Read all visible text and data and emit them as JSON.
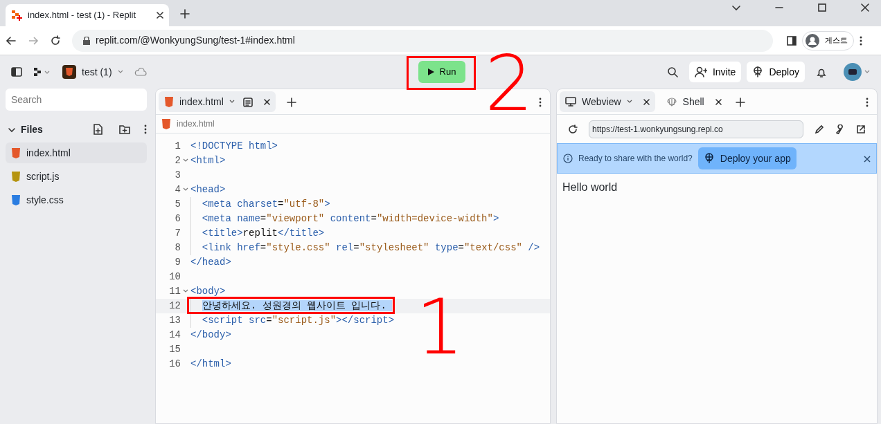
{
  "browser": {
    "tab_title": "index.html - test (1) - Replit",
    "url": "replit.com/@WonkyungSung/test-1#index.html",
    "profile": "게스트"
  },
  "toolbar": {
    "project": "test (1)",
    "run": "Run",
    "invite": "Invite",
    "deploy": "Deploy"
  },
  "sidebar": {
    "search_placeholder": "Search",
    "section": "Files",
    "expanded": true,
    "files": [
      {
        "name": "index.html",
        "kind": "html",
        "selected": true
      },
      {
        "name": "script.js",
        "kind": "js",
        "selected": false
      },
      {
        "name": "style.css",
        "kind": "css",
        "selected": false
      }
    ]
  },
  "editor": {
    "tab": "index.html",
    "breadcrumb": "index.html",
    "lines": [
      {
        "n": "1",
        "foldable": false,
        "selected": false,
        "indented": false,
        "segs": [
          {
            "kind": "tag",
            "text": "<!DOCTYPE html>"
          }
        ]
      },
      {
        "n": "2",
        "foldable": true,
        "selected": false,
        "indented": false,
        "segs": [
          {
            "kind": "tag",
            "text": "<html>"
          }
        ]
      },
      {
        "n": "3",
        "foldable": false,
        "selected": false
      },
      {
        "n": "4",
        "foldable": true,
        "selected": false,
        "indented": false,
        "segs": [
          {
            "kind": "tag",
            "text": "<head>"
          }
        ]
      },
      {
        "n": "5",
        "foldable": false,
        "selected": false,
        "indented": true,
        "segs": [
          {
            "kind": "tag",
            "text": "<meta"
          },
          {
            "kind": "attr",
            "text": "charset"
          },
          {
            "kind": "punct",
            "text": "="
          },
          {
            "kind": "str",
            "text": "\"utf-8\""
          },
          {
            "kind": "tag",
            "text": ">"
          }
        ]
      },
      {
        "n": "6",
        "foldable": false,
        "selected": false,
        "indented": true,
        "segs": [
          {
            "kind": "tag",
            "text": "<meta"
          },
          {
            "kind": "attr",
            "text": "name"
          },
          {
            "kind": "punct",
            "text": "="
          },
          {
            "kind": "str",
            "text": "\"viewport\""
          },
          {
            "kind": "attr",
            "text": "content"
          },
          {
            "kind": "punct",
            "text": "="
          },
          {
            "kind": "str",
            "text": "\"width=device-width\""
          },
          {
            "kind": "tag",
            "text": ">"
          }
        ]
      },
      {
        "n": "7",
        "foldable": false,
        "selected": false,
        "indented": true,
        "segs": [
          {
            "kind": "tag",
            "text": "<title>"
          },
          {
            "kind": "text",
            "text": "replit"
          },
          {
            "kind": "tag",
            "text": "</title>"
          }
        ]
      },
      {
        "n": "8",
        "foldable": false,
        "selected": false,
        "indented": true,
        "segs": [
          {
            "kind": "tag",
            "text": "<link"
          },
          {
            "kind": "attr",
            "text": "href"
          },
          {
            "kind": "punct",
            "text": "="
          },
          {
            "kind": "str",
            "text": "\"style.css\""
          },
          {
            "kind": "attr",
            "text": "rel"
          },
          {
            "kind": "punct",
            "text": "="
          },
          {
            "kind": "str",
            "text": "\"stylesheet\""
          },
          {
            "kind": "attr",
            "text": "type"
          },
          {
            "kind": "punct",
            "text": "="
          },
          {
            "kind": "str",
            "text": "\"text/css\""
          },
          {
            "kind": "tag",
            "text": "/>"
          }
        ]
      },
      {
        "n": "9",
        "foldable": false,
        "selected": false,
        "indented": false,
        "segs": [
          {
            "kind": "tag",
            "text": "</head>"
          }
        ]
      },
      {
        "n": "10",
        "foldable": false,
        "selected": false
      },
      {
        "n": "11",
        "foldable": true,
        "selected": false,
        "indented": false,
        "segs": [
          {
            "kind": "tag",
            "text": "<body>"
          }
        ]
      },
      {
        "n": "12",
        "foldable": false,
        "selected": true,
        "indented": true,
        "segs": [
          {
            "kind": "text",
            "text": "안녕하세요. 성원경의 웹사이트 입니다."
          }
        ]
      },
      {
        "n": "13",
        "foldable": false,
        "selected": false,
        "indented": true,
        "segs": [
          {
            "kind": "tag",
            "text": "<script"
          },
          {
            "kind": "attr",
            "text": "src"
          },
          {
            "kind": "punct",
            "text": "="
          },
          {
            "kind": "str",
            "text": "\"script.js\""
          },
          {
            "kind": "tag",
            "text": "></script>"
          }
        ]
      },
      {
        "n": "14",
        "foldable": false,
        "selected": false,
        "indented": false,
        "segs": [
          {
            "kind": "tag",
            "text": "</body>"
          }
        ]
      },
      {
        "n": "15",
        "foldable": false,
        "selected": false
      },
      {
        "n": "16",
        "foldable": false,
        "selected": false,
        "indented": false,
        "segs": [
          {
            "kind": "tag",
            "text": "</html>"
          }
        ]
      }
    ]
  },
  "preview": {
    "tabs": [
      {
        "label": "Webview",
        "kind": "webview",
        "selected": true
      },
      {
        "label": "Shell",
        "kind": "shell",
        "selected": false
      }
    ],
    "url": "https://test-1.wonkyungsung.repl.co",
    "banner": "Ready to share with the world?",
    "banner_button": "Deploy your app",
    "content": "Hello world"
  },
  "annotations": [
    {
      "label": "2"
    },
    {
      "label": "1"
    }
  ]
}
